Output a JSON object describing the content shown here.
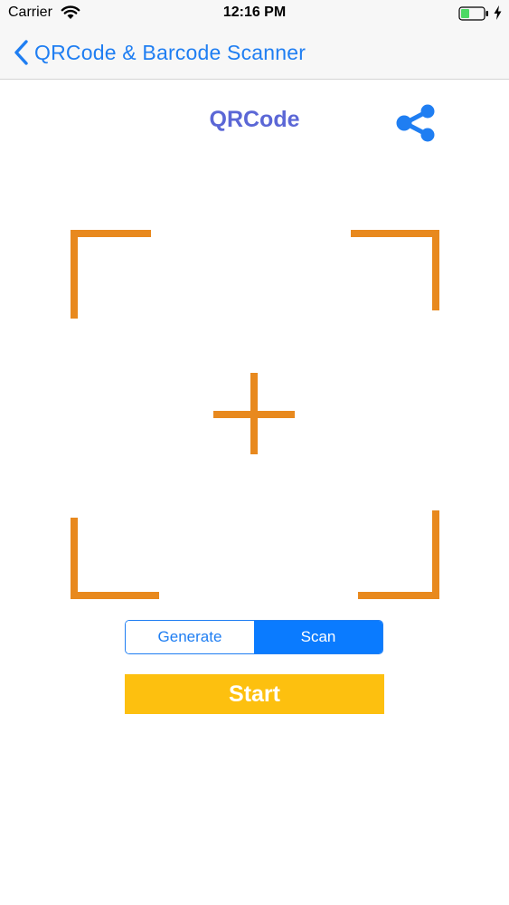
{
  "status_bar": {
    "carrier": "Carrier",
    "time": "12:16 PM"
  },
  "nav": {
    "back_label": "QRCode & Barcode Scanner"
  },
  "page": {
    "title": "QRCode"
  },
  "segmented_control": {
    "options": [
      "Generate",
      "Scan"
    ],
    "selected": "Scan"
  },
  "start_button": {
    "label": "Start"
  },
  "colors": {
    "accent_blue": "#1f7ef2",
    "title_purple": "#5b67d6",
    "frame_orange": "#e8891e",
    "start_yellow": "#fdc00f"
  },
  "icons": {
    "back": "chevron-left-icon",
    "share": "share-icon",
    "wifi": "wifi-icon",
    "battery": "battery-icon",
    "crosshair": "crosshair-icon"
  }
}
